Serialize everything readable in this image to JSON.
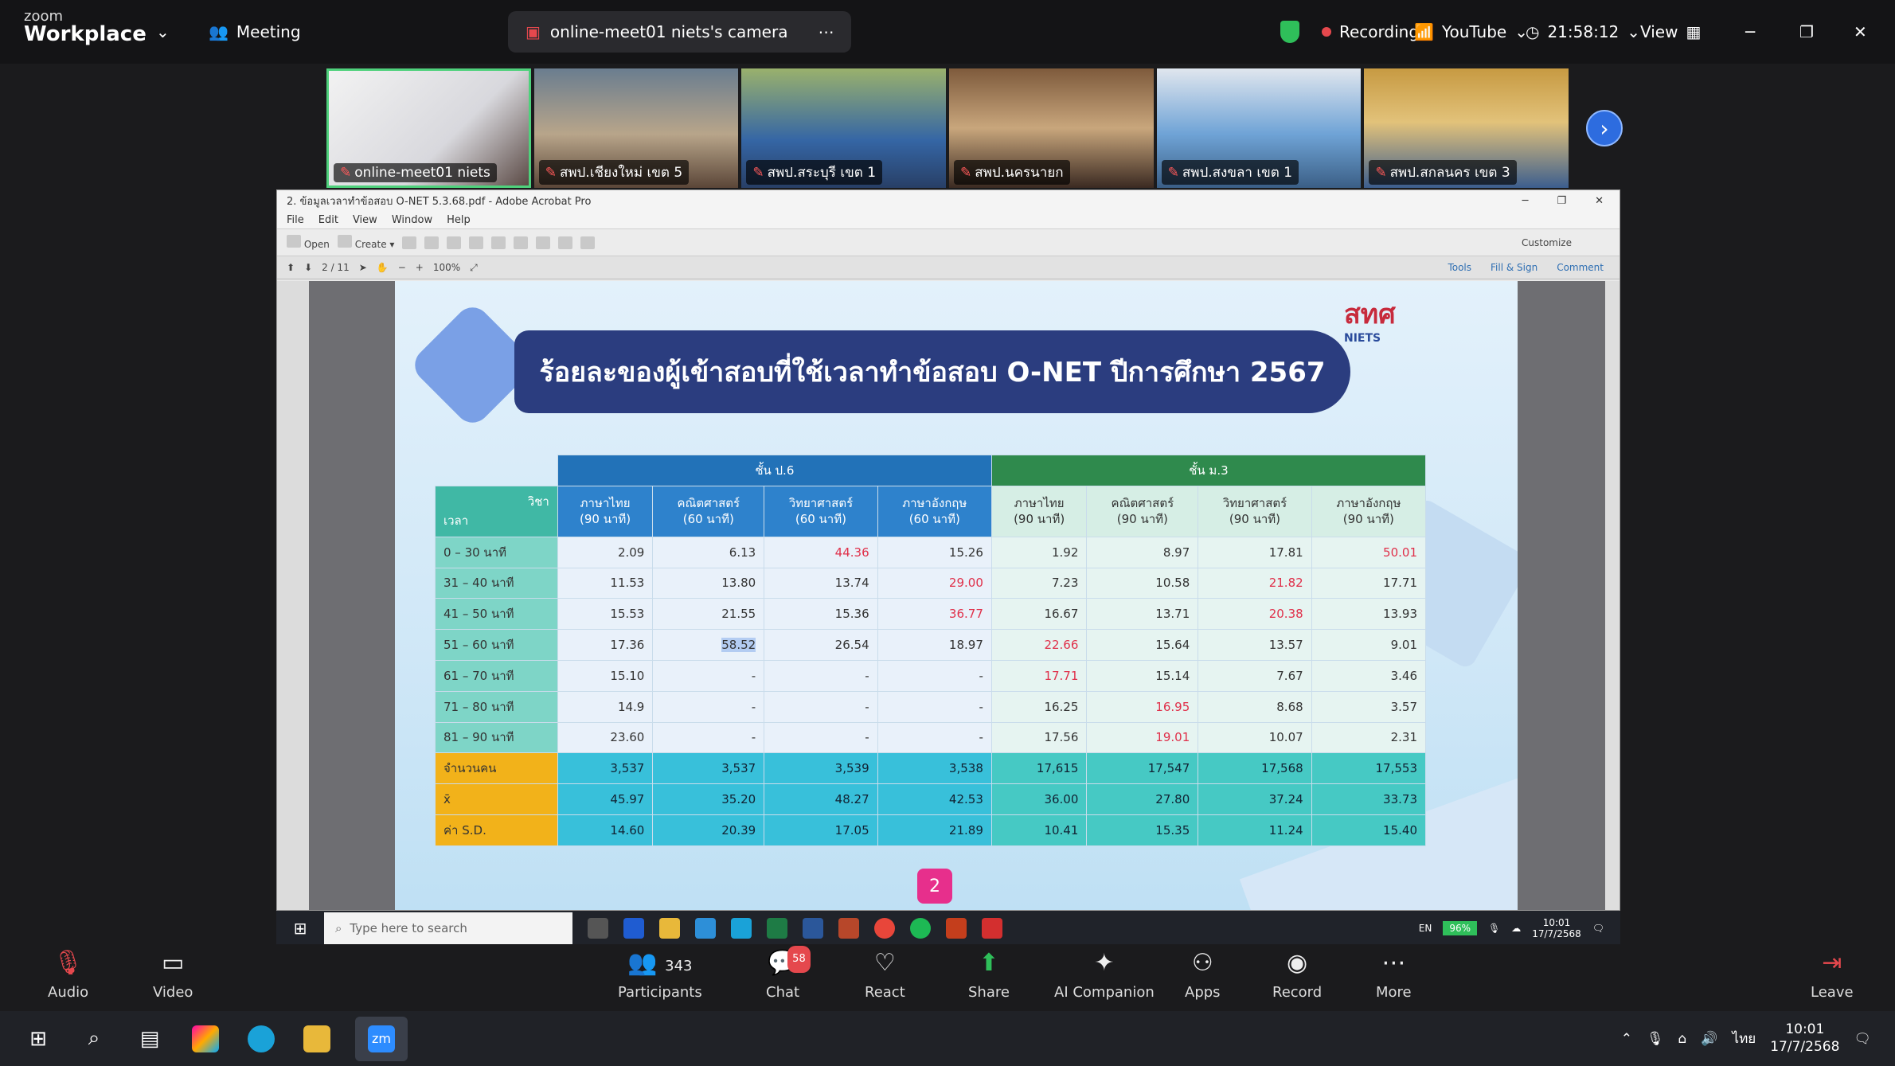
{
  "topbar": {
    "logo_small": "zoom",
    "logo_big": "Workplace",
    "meeting_label": "Meeting",
    "camera_tab": "online-meet01 niets's camera",
    "recording_label": "Recording",
    "youtube_label": "YouTube",
    "time": "21:58:12",
    "view_label": "View"
  },
  "video_strip": [
    {
      "name": "online-meet01 niets"
    },
    {
      "name": "สพป.เชียงใหม่ เขต 5"
    },
    {
      "name": "สพป.สระบุรี เขต 1"
    },
    {
      "name": "สพป.นครนายก"
    },
    {
      "name": "สพป.สงขลา เขต 1"
    },
    {
      "name": "สพป.สกลนคร เขต 3"
    }
  ],
  "acrobat": {
    "title": "2. ข้อมูลเวลาทำข้อสอบ O-NET 5.3.68.pdf - Adobe Acrobat Pro",
    "menu": [
      "File",
      "Edit",
      "View",
      "Window",
      "Help"
    ],
    "open_label": "Open",
    "create_label": "Create",
    "page_info": "2 / 11",
    "zoom": "100%",
    "customize": "Customize",
    "tools": "Tools",
    "fill_sign": "Fill & Sign",
    "comment": "Comment"
  },
  "slide": {
    "logo_text": "สทศ",
    "logo_sub": "NIETS",
    "title": "ร้อยละของผู้เข้าสอบที่ใช้เวลาทำข้อสอบ O-NET ปีการศึกษา 2567",
    "page_number": "2"
  },
  "table": {
    "group_p6": "ชั้น ป.6",
    "group_m3": "ชั้น ม.3",
    "corner_top": "วิชา",
    "corner_bottom": "เวลา",
    "subjects_p6": [
      {
        "name": "ภาษาไทย",
        "time": "(90 นาที)"
      },
      {
        "name": "คณิตศาสตร์",
        "time": "(60 นาที)"
      },
      {
        "name": "วิทยาศาสตร์",
        "time": "(60 นาที)"
      },
      {
        "name": "ภาษาอังกฤษ",
        "time": "(60 นาที)"
      }
    ],
    "subjects_m3": [
      {
        "name": "ภาษาไทย",
        "time": "(90 นาที)"
      },
      {
        "name": "คณิตศาสตร์",
        "time": "(90 นาที)"
      },
      {
        "name": "วิทยาศาสตร์",
        "time": "(90 นาที)"
      },
      {
        "name": "ภาษาอังกฤษ",
        "time": "(90 นาที)"
      }
    ],
    "rows": [
      {
        "label": "0 – 30 นาที",
        "values": [
          "2.09",
          "6.13",
          "44.36",
          "15.26",
          "1.92",
          "8.97",
          "17.81",
          "50.01"
        ]
      },
      {
        "label": "31 – 40 นาที",
        "values": [
          "11.53",
          "13.80",
          "13.74",
          "29.00",
          "7.23",
          "10.58",
          "21.82",
          "17.71"
        ]
      },
      {
        "label": "41 – 50 นาที",
        "values": [
          "15.53",
          "21.55",
          "15.36",
          "36.77",
          "16.67",
          "13.71",
          "20.38",
          "13.93"
        ]
      },
      {
        "label": "51 – 60 นาที",
        "values": [
          "17.36",
          "58.52",
          "26.54",
          "18.97",
          "22.66",
          "15.64",
          "13.57",
          "9.01"
        ]
      },
      {
        "label": "61 – 70 นาที",
        "values": [
          "15.10",
          "-",
          "-",
          "-",
          "17.71",
          "15.14",
          "7.67",
          "3.46"
        ]
      },
      {
        "label": "71 – 80 นาที",
        "values": [
          "14.9",
          "-",
          "-",
          "-",
          "16.25",
          "16.95",
          "8.68",
          "3.57"
        ]
      },
      {
        "label": "81 – 90 นาที",
        "values": [
          "23.60",
          "-",
          "-",
          "-",
          "17.56",
          "19.01",
          "10.07",
          "2.31"
        ]
      }
    ],
    "summary": [
      {
        "label": "จำนวนคน",
        "values": [
          "3,537",
          "3,537",
          "3,539",
          "3,538",
          "17,615",
          "17,547",
          "17,568",
          "17,553"
        ]
      },
      {
        "label": "x̄",
        "values": [
          "45.97",
          "35.20",
          "48.27",
          "42.53",
          "36.00",
          "27.80",
          "37.24",
          "33.73"
        ]
      },
      {
        "label": "ค่า S.D.",
        "values": [
          "14.60",
          "20.39",
          "17.05",
          "21.89",
          "10.41",
          "15.35",
          "11.24",
          "15.40"
        ]
      }
    ]
  },
  "remote_taskbar": {
    "search_placeholder": "Type here to search",
    "lang": "EN",
    "battery": "96%",
    "clock_time": "10:01",
    "clock_date": "17/7/2568"
  },
  "controls": {
    "audio": "Audio",
    "video": "Video",
    "participants": "Participants",
    "participants_count": "343",
    "chat": "Chat",
    "chat_badge": "58",
    "react": "React",
    "share": "Share",
    "ai": "AI Companion",
    "apps": "Apps",
    "record": "Record",
    "more": "More",
    "leave": "Leave"
  },
  "local_taskbar": {
    "zoom_label": "zm",
    "lang": "ไทย",
    "clock_time": "10:01",
    "clock_date": "17/7/2568"
  },
  "colors": {
    "p6_header": "#2272b8",
    "m3_header": "#2f8a4d",
    "title_bg": "#2b3d7f",
    "highlight_red": "#e0304a",
    "summary_label": "#f2b21a",
    "summary_row": "#38c0da"
  }
}
